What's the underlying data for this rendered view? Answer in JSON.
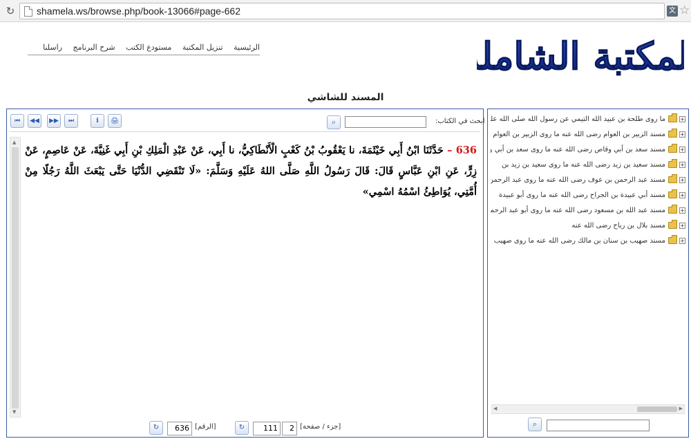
{
  "browser": {
    "url": "shamela.ws/browse.php/book-13066#page-662"
  },
  "nav": {
    "items": [
      "الرئيسية",
      "تنزيل المكتبة",
      "مستودع الكتب",
      "شرح البرنامج",
      "راسلنا"
    ]
  },
  "logo": {
    "text": "المكتبة الشاملة"
  },
  "book": {
    "title": "المسند للشاشي"
  },
  "toolbar": {
    "first": "⏮",
    "prev": "◀◀",
    "next": "▶▶",
    "last": "⏭",
    "info": "i",
    "print": "🖨",
    "search_label": "ابحث في الكتاب:",
    "search_value": "",
    "search_go": "⌕"
  },
  "content": {
    "number": "636",
    "dash": " – ",
    "text": "حَدَّثَنَا ابْنُ أَبِي خَيْثَمَةَ، نا يَعْقُوبُ بْنُ كَعْبٍ الْأَنْطَاكِيُّ، نا أَبِي، عَنْ عَبْدِ الْمَلِكِ بْنِ أَبِي غَنِيَّةَ، عَنْ عَاصِمٍ، عَنْ زِرٍّ، عَنِ ابْنِ عَبَّاسٍ قَالَ: قَالَ رَسُولُ اللَّهِ صَلَّى اللهُ عَلَيْهِ وَسَلَّمَ: «لَا تَنْقَضِي الدُّنْيَا حَتَّى يَبْعَثَ اللَّهُ رَجُلًا مِنْ أُمَّتِي، يُوَاطِئُ اسْمُهُ اسْمِي»"
  },
  "footer": {
    "part_page_label": "[جزء / صفحة]",
    "part": "2",
    "page": "111",
    "number_label": "[الرقم]",
    "number": "636",
    "go": "↻"
  },
  "tree": {
    "items": [
      "ما روى طلحة بن عبيد الله التيمي عن رسول الله صلى الله عليه وسلم",
      "مسند الزبير بن العوام رضى الله عنه ما روى الزبير بن العوام",
      "مسند سعد بن أبي وقاص رضى الله عنه ما روى سعد بن أبي وقاص",
      "مسند سعيد بن زيد رضى الله عنه ما روى سعيد بن زيد بن",
      "مسند عبد الرحمن بن عوف رضى الله عنه ما روى عبد الرحمن",
      "مسند أبي عبيدة بن الجراح رضى الله عنه ما روى أبو عبيدة",
      "مسند عبد الله بن مسعود رضى الله عنه ما روى أبو عبد الرحمن",
      "مسند بلال بن رباح رضى الله عنه",
      "مسند صهيب بن سنان بن مالك رضى الله عنه ما روى صهيب"
    ],
    "search_value": "",
    "search_go": "⌕"
  }
}
